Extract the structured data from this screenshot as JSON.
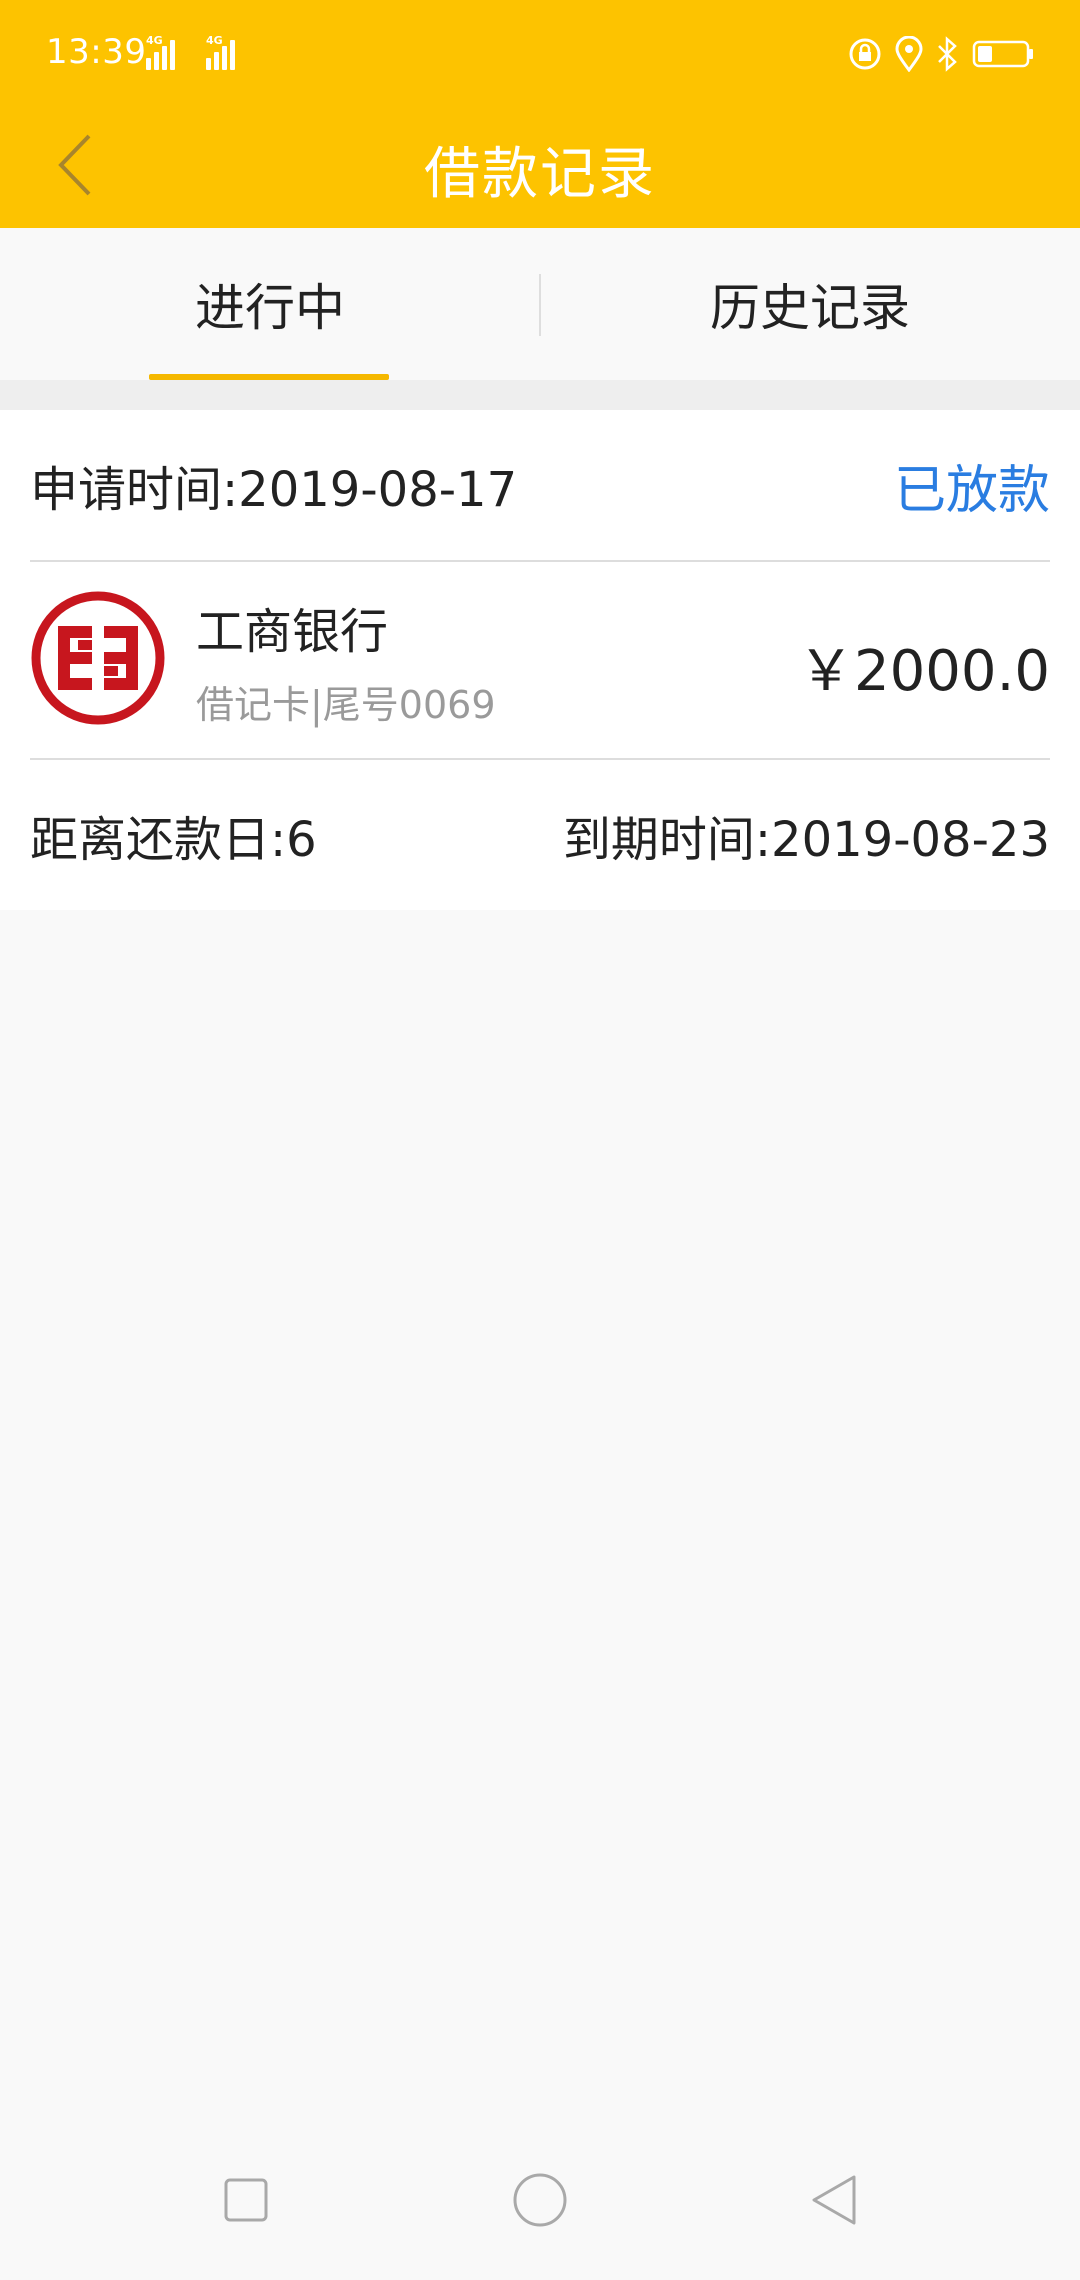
{
  "status_bar": {
    "time": "13:39",
    "network1": "4G",
    "network2": "4G"
  },
  "header": {
    "title": "借款记录",
    "back_icon": "chevron-left-icon",
    "bg_color": "#fdc300"
  },
  "tabs": [
    {
      "label": "进行中",
      "active": true
    },
    {
      "label": "历史记录",
      "active": false
    }
  ],
  "loan": {
    "apply_time": "申请时间:2019-08-17",
    "status": "已放款",
    "status_color": "#2a7de1",
    "bank_name": "工商银行",
    "card_info": "借记卡|尾号0069",
    "amount": "￥2000.0",
    "days_left": "距离还款日:6",
    "due_date": "到期时间:2019-08-23",
    "bank_icon": "icbc-logo-icon",
    "bank_color": "#c7161e"
  },
  "nav": {
    "recent_icon": "square-icon",
    "home_icon": "circle-icon",
    "back_icon": "triangle-back-icon"
  }
}
